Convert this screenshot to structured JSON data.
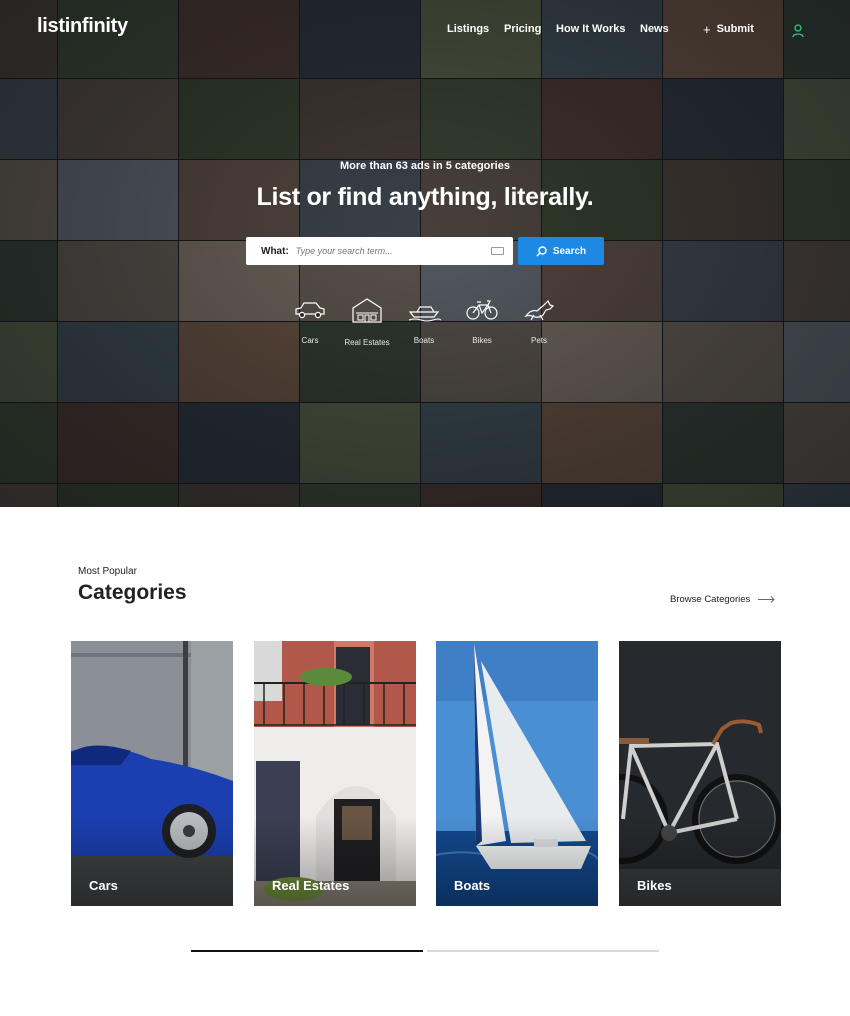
{
  "brand": {
    "logo": "listinfinity"
  },
  "nav": {
    "listings": "Listings",
    "pricing": "Pricing",
    "how_it_works": "How It Works",
    "news": "News",
    "submit": "Submit"
  },
  "hero": {
    "subtitle": "More than 63 ads in 5 categories",
    "title": "List or find anything, literally.",
    "search": {
      "what_label": "What:",
      "placeholder": "Type your search term...",
      "button": "Search"
    },
    "categories": [
      {
        "label": "Cars",
        "icon": "car-icon"
      },
      {
        "label": "Real Estates",
        "icon": "house-icon"
      },
      {
        "label": "Boats",
        "icon": "boat-icon"
      },
      {
        "label": "Bikes",
        "icon": "bike-icon"
      },
      {
        "label": "Pets",
        "icon": "pet-icon"
      }
    ]
  },
  "categories_section": {
    "eyebrow": "Most Popular",
    "title": "Categories",
    "browse_link": "Browse Categories",
    "cards": [
      {
        "label": "Cars"
      },
      {
        "label": "Real Estates"
      },
      {
        "label": "Boats"
      },
      {
        "label": "Bikes"
      }
    ]
  },
  "colors": {
    "accent": "#1e88e5",
    "user_icon": "#2ecc71",
    "text_dark": "#222222"
  }
}
